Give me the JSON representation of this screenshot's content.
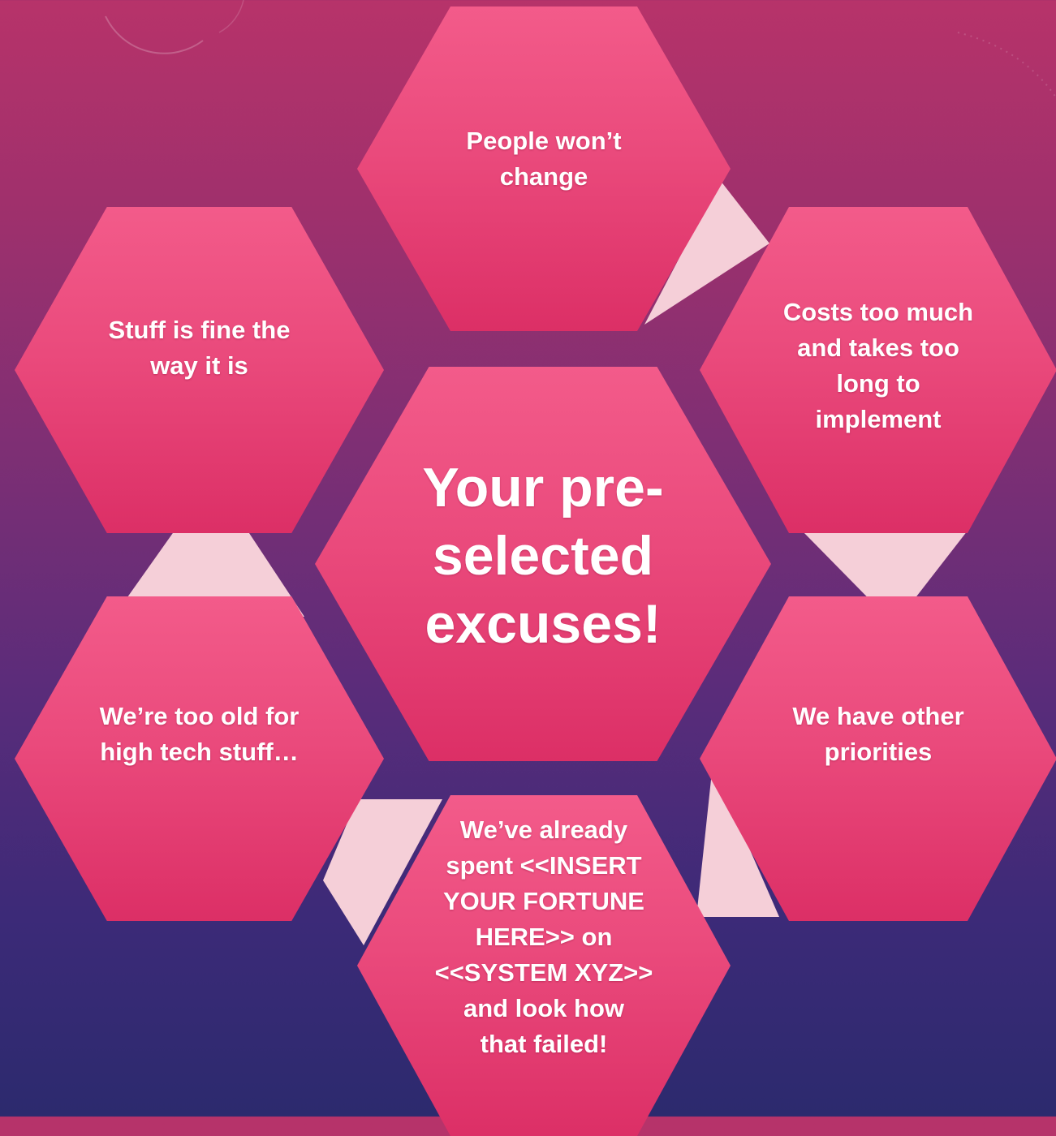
{
  "colors": {
    "hexagon": "#ea4a7c",
    "hexagon_dark": "#dc2f66",
    "connector": "#f5cfd8",
    "background_top": "#b7336a",
    "background_bottom": "#2c2a6e"
  },
  "center": {
    "lines": [
      "Your pre-",
      "selected",
      "excuses!"
    ]
  },
  "excuses": {
    "top": {
      "lines": [
        "People won’t",
        "change"
      ]
    },
    "top_right": {
      "lines": [
        "Costs too much",
        "and takes too",
        "long to",
        "implement"
      ]
    },
    "bottom_right": {
      "lines": [
        "We have other",
        "priorities"
      ]
    },
    "bottom": {
      "lines": [
        "We’ve already",
        "spent <<INSERT",
        "YOUR FORTUNE",
        "HERE>> on",
        "<<SYSTEM XYZ>>",
        "and look how",
        "that failed!"
      ]
    },
    "bottom_left": {
      "lines": [
        "We’re too old for",
        "high tech stuff…"
      ]
    },
    "top_left": {
      "lines": [
        "Stuff is fine the",
        "way it is"
      ]
    }
  }
}
